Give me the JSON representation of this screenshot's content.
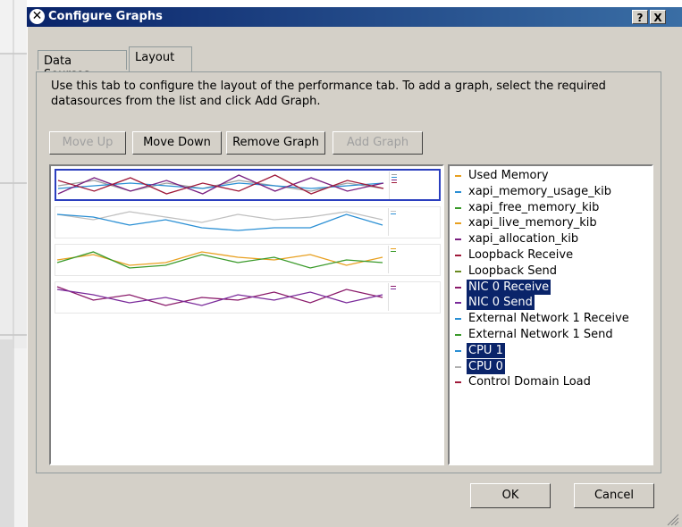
{
  "dialog": {
    "title": "Configure Graphs",
    "help_button": "?",
    "close_button": "X"
  },
  "tabs": [
    {
      "label": "Data Sources",
      "selected": false
    },
    {
      "label": "Layout",
      "selected": true
    }
  ],
  "instructions": "Use this tab to configure the layout of the performance tab. To add a graph, select the required datasources from the list and click Add Graph.",
  "buttons": {
    "move_up": "Move Up",
    "move_down": "Move Down",
    "remove_graph": "Remove Graph",
    "add_graph": "Add Graph"
  },
  "graphs": [
    {
      "selected": true,
      "series": [
        {
          "color": "#a0a0a0",
          "values": [
            0.5,
            0.7,
            0.3,
            0.6,
            0.4,
            0.7,
            0.5,
            0.3,
            0.6,
            0.4
          ]
        },
        {
          "color": "#2a8fd4",
          "values": [
            0.4,
            0.5,
            0.6,
            0.5,
            0.4,
            0.6,
            0.5,
            0.4,
            0.5,
            0.6
          ]
        },
        {
          "color": "#7a2080",
          "values": [
            0.2,
            0.8,
            0.3,
            0.7,
            0.2,
            0.9,
            0.3,
            0.8,
            0.3,
            0.6
          ]
        },
        {
          "color": "#a01a3a",
          "values": [
            0.7,
            0.3,
            0.8,
            0.2,
            0.6,
            0.3,
            0.9,
            0.2,
            0.7,
            0.4
          ]
        }
      ]
    },
    {
      "selected": false,
      "series": [
        {
          "color": "#c0c0c0",
          "values": [
            0.8,
            0.6,
            0.9,
            0.7,
            0.5,
            0.8,
            0.6,
            0.7,
            0.9,
            0.6
          ]
        },
        {
          "color": "#2a8fd4",
          "values": [
            0.8,
            0.7,
            0.4,
            0.6,
            0.3,
            0.2,
            0.3,
            0.3,
            0.8,
            0.4
          ]
        }
      ]
    },
    {
      "selected": false,
      "series": [
        {
          "color": "#e8a020",
          "values": [
            0.5,
            0.7,
            0.3,
            0.4,
            0.8,
            0.6,
            0.5,
            0.7,
            0.3,
            0.6
          ]
        },
        {
          "color": "#3a9a2a",
          "values": [
            0.4,
            0.8,
            0.2,
            0.3,
            0.7,
            0.4,
            0.6,
            0.2,
            0.5,
            0.4
          ]
        }
      ]
    },
    {
      "selected": false,
      "series": [
        {
          "color": "#8a1a6a",
          "values": [
            0.9,
            0.4,
            0.6,
            0.2,
            0.5,
            0.4,
            0.7,
            0.3,
            0.8,
            0.5
          ]
        },
        {
          "color": "#7a2a9a",
          "values": [
            0.8,
            0.6,
            0.3,
            0.5,
            0.2,
            0.6,
            0.4,
            0.7,
            0.3,
            0.6
          ]
        }
      ]
    }
  ],
  "datasources": [
    {
      "label": "Used Memory",
      "color": "#e8a020",
      "selected": false
    },
    {
      "label": "xapi_memory_usage_kib",
      "color": "#2a8fd4",
      "selected": false
    },
    {
      "label": "xapi_free_memory_kib",
      "color": "#3a9a2a",
      "selected": false
    },
    {
      "label": "xapi_live_memory_kib",
      "color": "#e8a020",
      "selected": false
    },
    {
      "label": "xapi_allocation_kib",
      "color": "#7a2080",
      "selected": false
    },
    {
      "label": "Loopback Receive",
      "color": "#a01a3a",
      "selected": false
    },
    {
      "label": "Loopback Send",
      "color": "#6a8a20",
      "selected": false
    },
    {
      "label": "NIC 0 Receive",
      "color": "#8a1a6a",
      "selected": true
    },
    {
      "label": "NIC 0 Send",
      "color": "#7a2a9a",
      "selected": true
    },
    {
      "label": "External Network 1 Receive",
      "color": "#2a8fd4",
      "selected": false
    },
    {
      "label": "External Network 1 Send",
      "color": "#3a9a2a",
      "selected": false
    },
    {
      "label": "CPU 1",
      "color": "#2a8fd4",
      "selected": true
    },
    {
      "label": "CPU 0",
      "color": "#b0b0b0",
      "selected": true
    },
    {
      "label": "Control Domain Load",
      "color": "#a01a3a",
      "selected": false
    }
  ],
  "footer": {
    "ok": "OK",
    "cancel": "Cancel"
  }
}
